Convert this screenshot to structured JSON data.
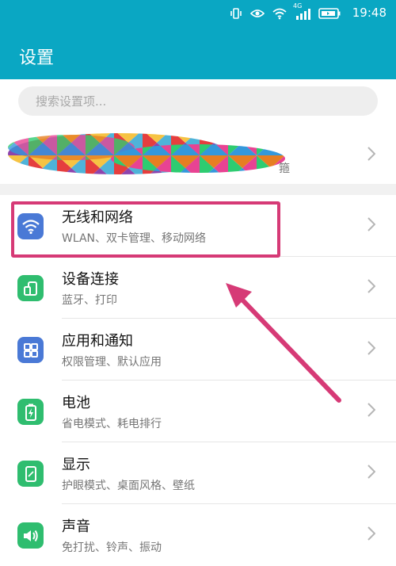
{
  "status": {
    "time": "19:48",
    "network": "4G",
    "icons": [
      "vibrate-icon",
      "eye-icon",
      "wifi-icon",
      "signal-icon",
      "battery-icon"
    ]
  },
  "header": {
    "title": "设置",
    "color": "#0aa7c3"
  },
  "search": {
    "placeholder": "搜索设置项..."
  },
  "profile": {
    "partial_text": "箍"
  },
  "items": [
    {
      "title": "无线和网络",
      "subtitle": "WLAN、双卡管理、移动网络",
      "icon": "wifi-icon",
      "color": "#4a79d6"
    },
    {
      "title": "设备连接",
      "subtitle": "蓝牙、打印",
      "icon": "device-connection-icon",
      "color": "#2fbd6f"
    },
    {
      "title": "应用和通知",
      "subtitle": "权限管理、默认应用",
      "icon": "apps-icon",
      "color": "#4a79d6"
    },
    {
      "title": "电池",
      "subtitle": "省电模式、耗电排行",
      "icon": "battery-icon",
      "color": "#2fbd6f"
    },
    {
      "title": "显示",
      "subtitle": "护眼模式、桌面风格、壁纸",
      "icon": "display-icon",
      "color": "#2fbd6f"
    },
    {
      "title": "声音",
      "subtitle": "免打扰、铃声、振动",
      "icon": "sound-icon",
      "color": "#2fbd6f"
    }
  ],
  "annotation_color": "#d63a76"
}
